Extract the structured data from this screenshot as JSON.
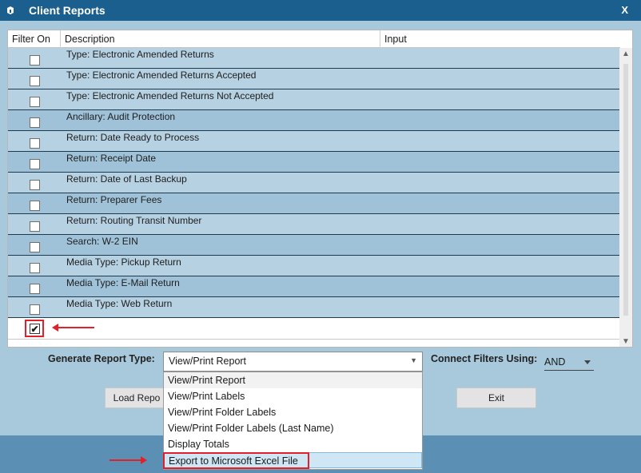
{
  "window": {
    "title": "Client Reports",
    "close_label": "X"
  },
  "grid": {
    "columns": [
      "Filter On",
      "Description",
      "Input"
    ],
    "rows": [
      {
        "description": "Type: Electronic Amended Returns",
        "checked": false
      },
      {
        "description": "Type: Electronic Amended Returns Accepted",
        "checked": false
      },
      {
        "description": "Type: Electronic Amended Returns Not Accepted",
        "checked": false
      },
      {
        "description": "Ancillary: Audit Protection",
        "checked": false
      },
      {
        "description": "Return: Date Ready to Process",
        "checked": false
      },
      {
        "description": "Return: Receipt Date",
        "checked": false
      },
      {
        "description": "Return: Date of Last Backup",
        "checked": false
      },
      {
        "description": "Return: Preparer Fees",
        "checked": false
      },
      {
        "description": "Return: Routing Transit Number",
        "checked": false
      },
      {
        "description": "Search: W-2 EIN",
        "checked": false
      },
      {
        "description": "Media Type: Pickup Return",
        "checked": false
      },
      {
        "description": "Media Type: E-Mail Return",
        "checked": false
      },
      {
        "description": "Media Type: Web Return",
        "checked": false
      }
    ],
    "new_row_check_glyph": "✔"
  },
  "controls": {
    "generate_label": "Generate Report Type:",
    "generate_value": "View/Print Report",
    "connect_label": "Connect Filters Using:",
    "connect_value": "AND",
    "load_button": "Load Repo",
    "exit_button": "Exit"
  },
  "dropdown": {
    "options": [
      "View/Print Report",
      "View/Print Labels",
      "View/Print Folder Labels",
      "View/Print Folder Labels (Last Name)",
      "Display Totals",
      "Export to Microsoft Excel File"
    ],
    "selected_index": 5
  },
  "colors": {
    "title_bar": "#1a5f8d",
    "row_light": "#b5d1e2",
    "row_mid": "#9fc2d8",
    "highlight": "#e0202a"
  },
  "icons": [
    "app-icon",
    "close-icon",
    "scroll-up-icon",
    "scroll-down-icon",
    "chevron-down-icon",
    "red-arrow-icon"
  ]
}
